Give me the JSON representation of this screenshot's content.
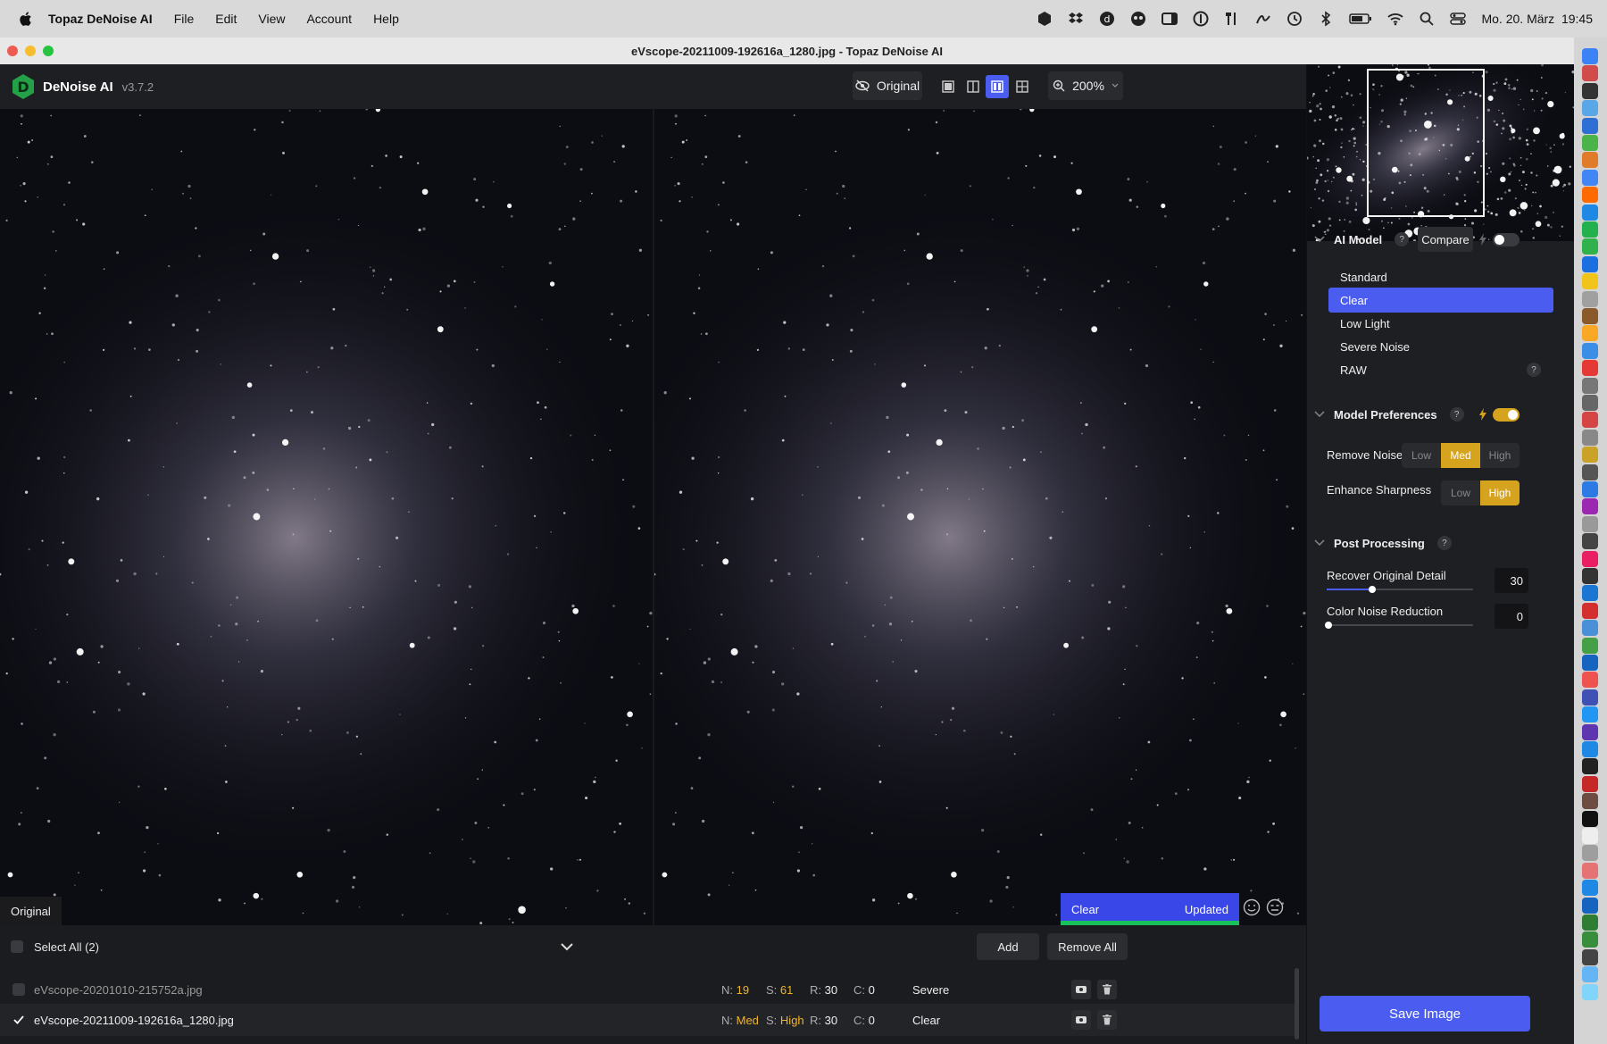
{
  "menubar": {
    "app": "Topaz DeNoise AI",
    "items": [
      "File",
      "Edit",
      "View",
      "Account",
      "Help"
    ],
    "clock": "Mo. 20. März  19:45"
  },
  "window": {
    "title": "eVscope-20211009-192616a_1280.jpg - Topaz DeNoise AI"
  },
  "header": {
    "app_name": "DeNoise AI",
    "version": "v3.7.2",
    "original_label": "Original",
    "zoom": "200%"
  },
  "canvas": {
    "left_label": "Original",
    "status_model": "Clear",
    "status_state": "Updated"
  },
  "files": {
    "select_all": "Select All (2)",
    "add": "Add",
    "remove_all": "Remove All",
    "rows": [
      {
        "name": "eVscope-20201010-215752a.jpg",
        "n": "19",
        "s": "61",
        "r": "30",
        "c": "0",
        "model": "Severe",
        "checked": false
      },
      {
        "name": "eVscope-20211009-192616a_1280.jpg",
        "n": "Med",
        "s": "High",
        "r": "30",
        "c": "0",
        "model": "Clear",
        "checked": true
      }
    ],
    "keys": {
      "n": "N:",
      "s": "S:",
      "r": "R:",
      "c": "C:"
    }
  },
  "panel": {
    "ai_model": "AI Model",
    "compare": "Compare",
    "models": [
      "Standard",
      "Clear",
      "Low Light",
      "Severe Noise",
      "RAW"
    ],
    "selected_model": "Clear",
    "model_prefs": "Model Preferences",
    "remove_noise": {
      "label": "Remove Noise",
      "options": [
        "Low",
        "Med",
        "High"
      ],
      "selected": "Med"
    },
    "enhance_sharpness": {
      "label": "Enhance Sharpness",
      "options": [
        "Low",
        "High"
      ],
      "selected": "High"
    },
    "post_processing": "Post Processing",
    "recover_detail": {
      "label": "Recover Original Detail",
      "value": "30",
      "fraction": 0.3
    },
    "color_noise": {
      "label": "Color Noise Reduction",
      "value": "0",
      "fraction": 0.0
    },
    "save": "Save Image"
  },
  "colors": {
    "accent": "#4a5df0",
    "selected_model": "#4a5df0",
    "toggle_on": "#d6a31e",
    "value_yellow": "#f0b429",
    "progress_green": "#19c15a"
  }
}
